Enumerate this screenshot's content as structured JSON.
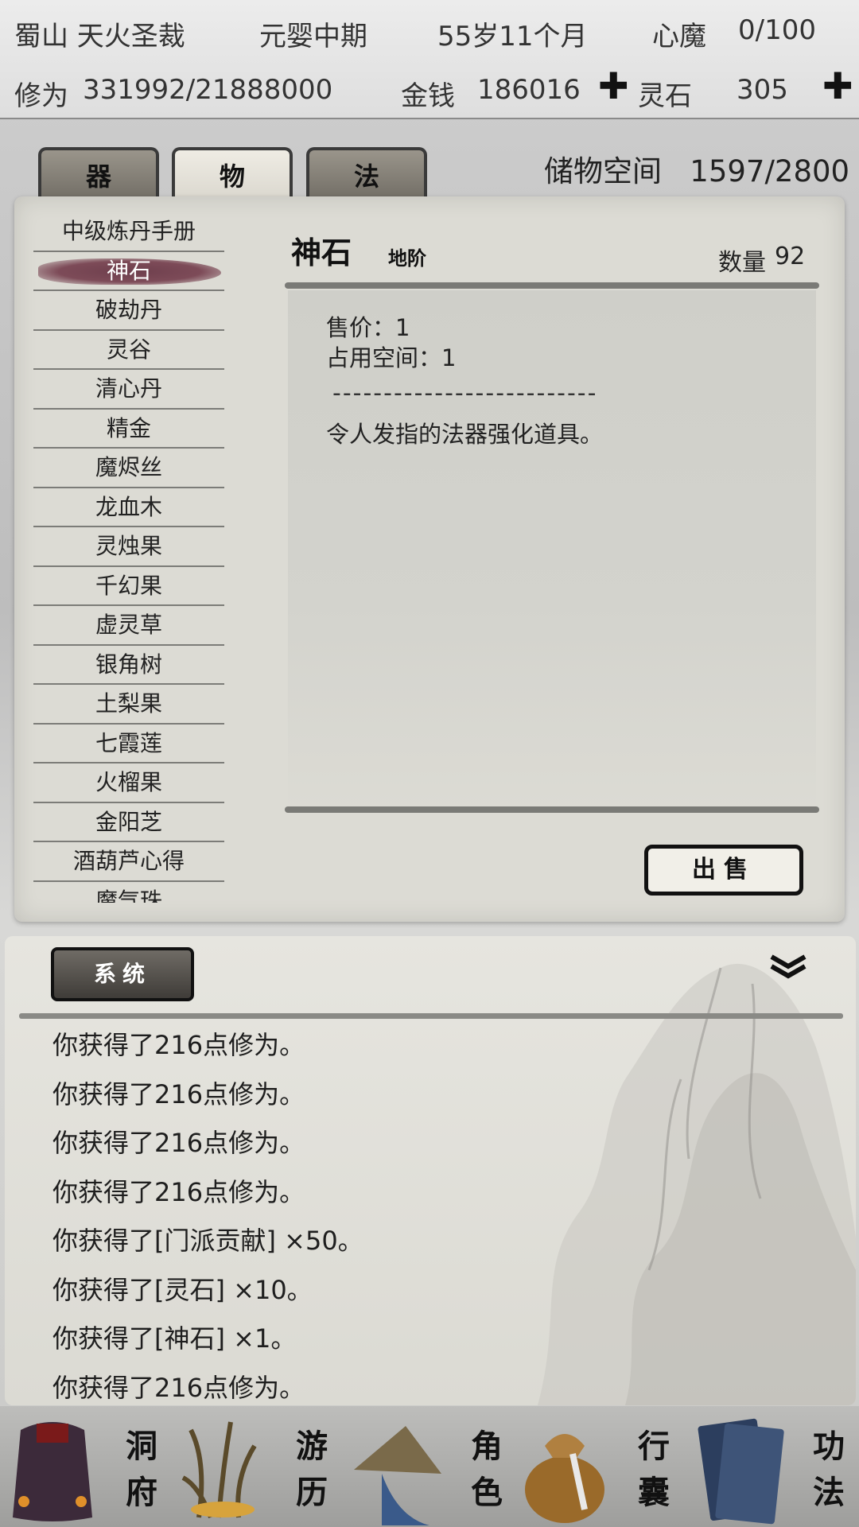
{
  "status": {
    "sect_title": "蜀山 天火圣裁",
    "realm": "元婴中期",
    "age": "55岁11个月",
    "demon_label": "心魔",
    "demon_value": "0/100",
    "cultivation_label": "修为",
    "cultivation_value": "331992/21888000",
    "money_label": "金钱",
    "money_value": "186016",
    "spirit_stone_label": "灵石",
    "spirit_stone_value": "305",
    "plus_glyph": "✚"
  },
  "tabs": [
    {
      "label": "器",
      "active": false
    },
    {
      "label": "物",
      "active": true
    },
    {
      "label": "法",
      "active": false
    }
  ],
  "storage": {
    "label": "储物空间",
    "value": "1597/2800"
  },
  "item_list": [
    "中级炼丹手册",
    "神石",
    "破劫丹",
    "灵谷",
    "清心丹",
    "精金",
    "魔烬丝",
    "龙血木",
    "灵烛果",
    "千幻果",
    "虚灵草",
    "银角树",
    "土梨果",
    "七霞莲",
    "火榴果",
    "金阳芝",
    "酒葫芦心得",
    "魔气珠"
  ],
  "selected_index": 1,
  "detail": {
    "name": "神石",
    "grade": "地阶",
    "qty_label": "数量",
    "qty": "92",
    "price_line": "售价：1",
    "space_line": "占用空间：1",
    "divider": "--------------------------",
    "description": "令人发指的法器强化道具。",
    "sell_label": "出售"
  },
  "log": {
    "tab_label": "系统",
    "collapse_icon": "double-chevron-down-icon",
    "lines": [
      "你获得了216点修为。",
      "你获得了216点修为。",
      "你获得了216点修为。",
      "你获得了216点修为。",
      "你获得了[门派贡献] ×50。",
      "你获得了[灵石] ×10。",
      "你获得了[神石] ×1。",
      "你获得了216点修为。"
    ]
  },
  "nav": [
    {
      "label_top": "洞",
      "label_bottom": "府",
      "icon": "cave-banner-icon"
    },
    {
      "label_top": "游",
      "label_bottom": "历",
      "icon": "grass-icon"
    },
    {
      "label_top": "角",
      "label_bottom": "色",
      "icon": "straw-hat-icon"
    },
    {
      "label_top": "行",
      "label_bottom": "囊",
      "icon": "pouch-icon"
    },
    {
      "label_top": "功",
      "label_bottom": "法",
      "icon": "scroll-book-icon"
    }
  ],
  "colors": {
    "selected_item": "#7d4b58",
    "tab_inactive": "#7f7a72",
    "tab_active": "#e8e5dd",
    "panel": "#dcdbd4"
  }
}
